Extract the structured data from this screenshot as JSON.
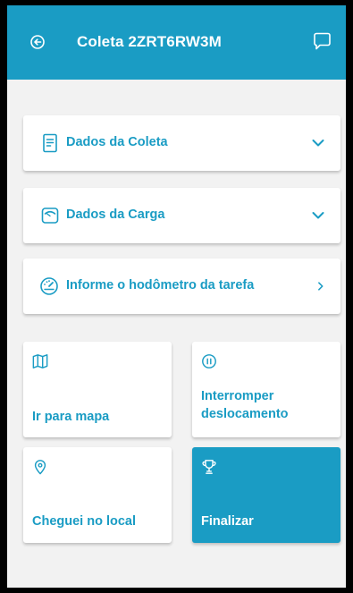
{
  "header": {
    "title": "Coleta 2ZRT6RW3M",
    "back_icon": "back-arrow-circle-icon",
    "chat_icon": "chat-bubble-icon"
  },
  "sections": [
    {
      "label": "Dados da Coleta",
      "icon": "document-icon",
      "action_icon": "chevron-down-icon"
    },
    {
      "label": "Dados da Carga",
      "icon": "cargo-icon",
      "action_icon": "chevron-down-icon"
    },
    {
      "label": "Informe o hodômetro da tarefa",
      "icon": "speedometer-icon",
      "action_icon": "chevron-right-icon"
    }
  ],
  "actions": [
    {
      "label": "Ir para mapa",
      "icon": "map-icon"
    },
    {
      "label_line1": "Interromper",
      "label_line2": "deslocamento",
      "icon": "pause-icon"
    },
    {
      "label": "Cheguei no local",
      "icon": "location-pin-icon"
    },
    {
      "label": "Finalizar",
      "icon": "trophy-icon"
    }
  ],
  "colors": {
    "primary": "#1a9cc4",
    "background": "#f2f2f2",
    "card": "#ffffff"
  }
}
